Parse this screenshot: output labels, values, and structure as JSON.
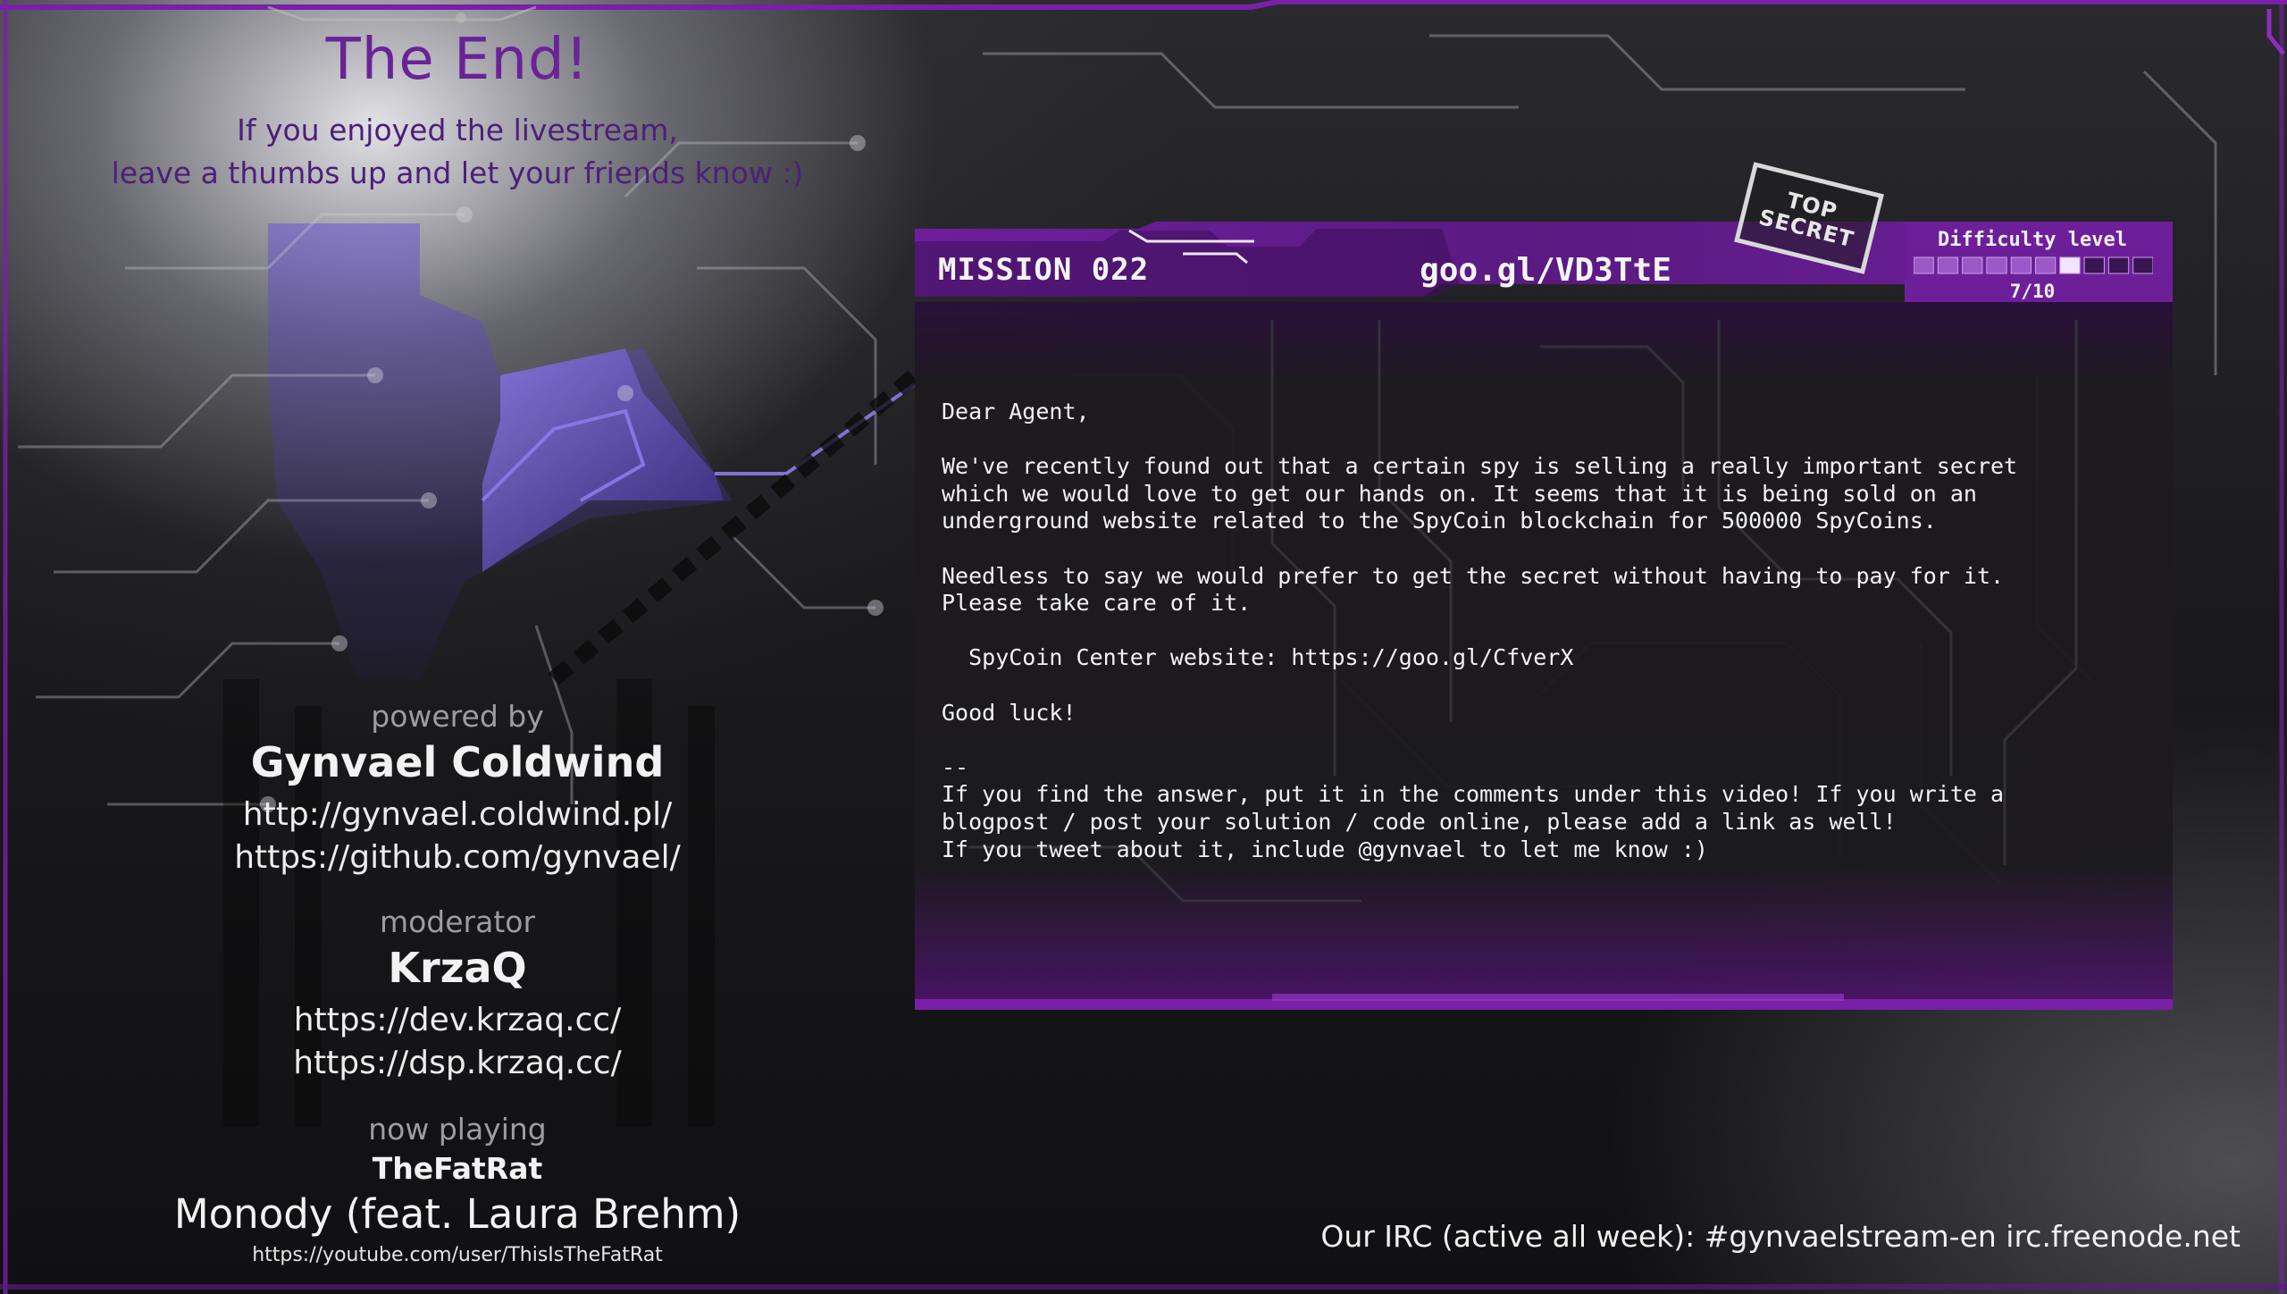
{
  "outro": {
    "title": "The End!",
    "subtitle_line1": "If you enjoyed the livestream,",
    "subtitle_line2": "leave a thumbs up and let your friends know :)"
  },
  "credits": {
    "powered_by_label": "powered by",
    "host_name": "Gynvael Coldwind",
    "host_links": [
      "http://gynvael.coldwind.pl/",
      "https://github.com/gynvael/"
    ],
    "moderator_label": "moderator",
    "moderator_name": "KrzaQ",
    "moderator_links": [
      "https://dev.krzaq.cc/",
      "https://dsp.krzaq.cc/"
    ],
    "now_playing_label": "now playing",
    "artist": "TheFatRat",
    "song": "Monody (feat. Laura Brehm)",
    "artist_url": "https://youtube.com/user/ThisIsTheFatRat"
  },
  "mission": {
    "label": "MISSION 022",
    "url": "goo.gl/VD3TtE",
    "stamp_line1": "TOP",
    "stamp_line2": "SECRET",
    "difficulty_label": "Difficulty level",
    "difficulty_value": "7/10",
    "difficulty_level": 7,
    "difficulty_max": 10,
    "message_lines": [
      "Dear Agent,",
      "",
      "We've recently found out that a certain spy is selling a really important secret",
      "which we would love to get our hands on. It seems that it is being sold on an",
      "underground website related to the SpyCoin blockchain for 500000 SpyCoins.",
      "",
      "Needless to say we would prefer to get the secret without having to pay for it.",
      "Please take care of it.",
      "",
      "  SpyCoin Center website: https://goo.gl/CfverX",
      "",
      "Good luck!",
      "",
      "--",
      "If you find the answer, put it in the comments under this video! If you write a",
      "blogpost / post your solution / code online, please add a link as well!",
      "If you tweet about it, include @gynvael to let me know :)"
    ]
  },
  "footer": {
    "irc_text": "Our IRC (active all week): #gynvaelstream-en irc.freenode.net"
  },
  "colors": {
    "accent_purple": "#7a1fa8",
    "accent_dark_purple": "#4d1f78",
    "panel_bg": "#1b1a1d"
  }
}
